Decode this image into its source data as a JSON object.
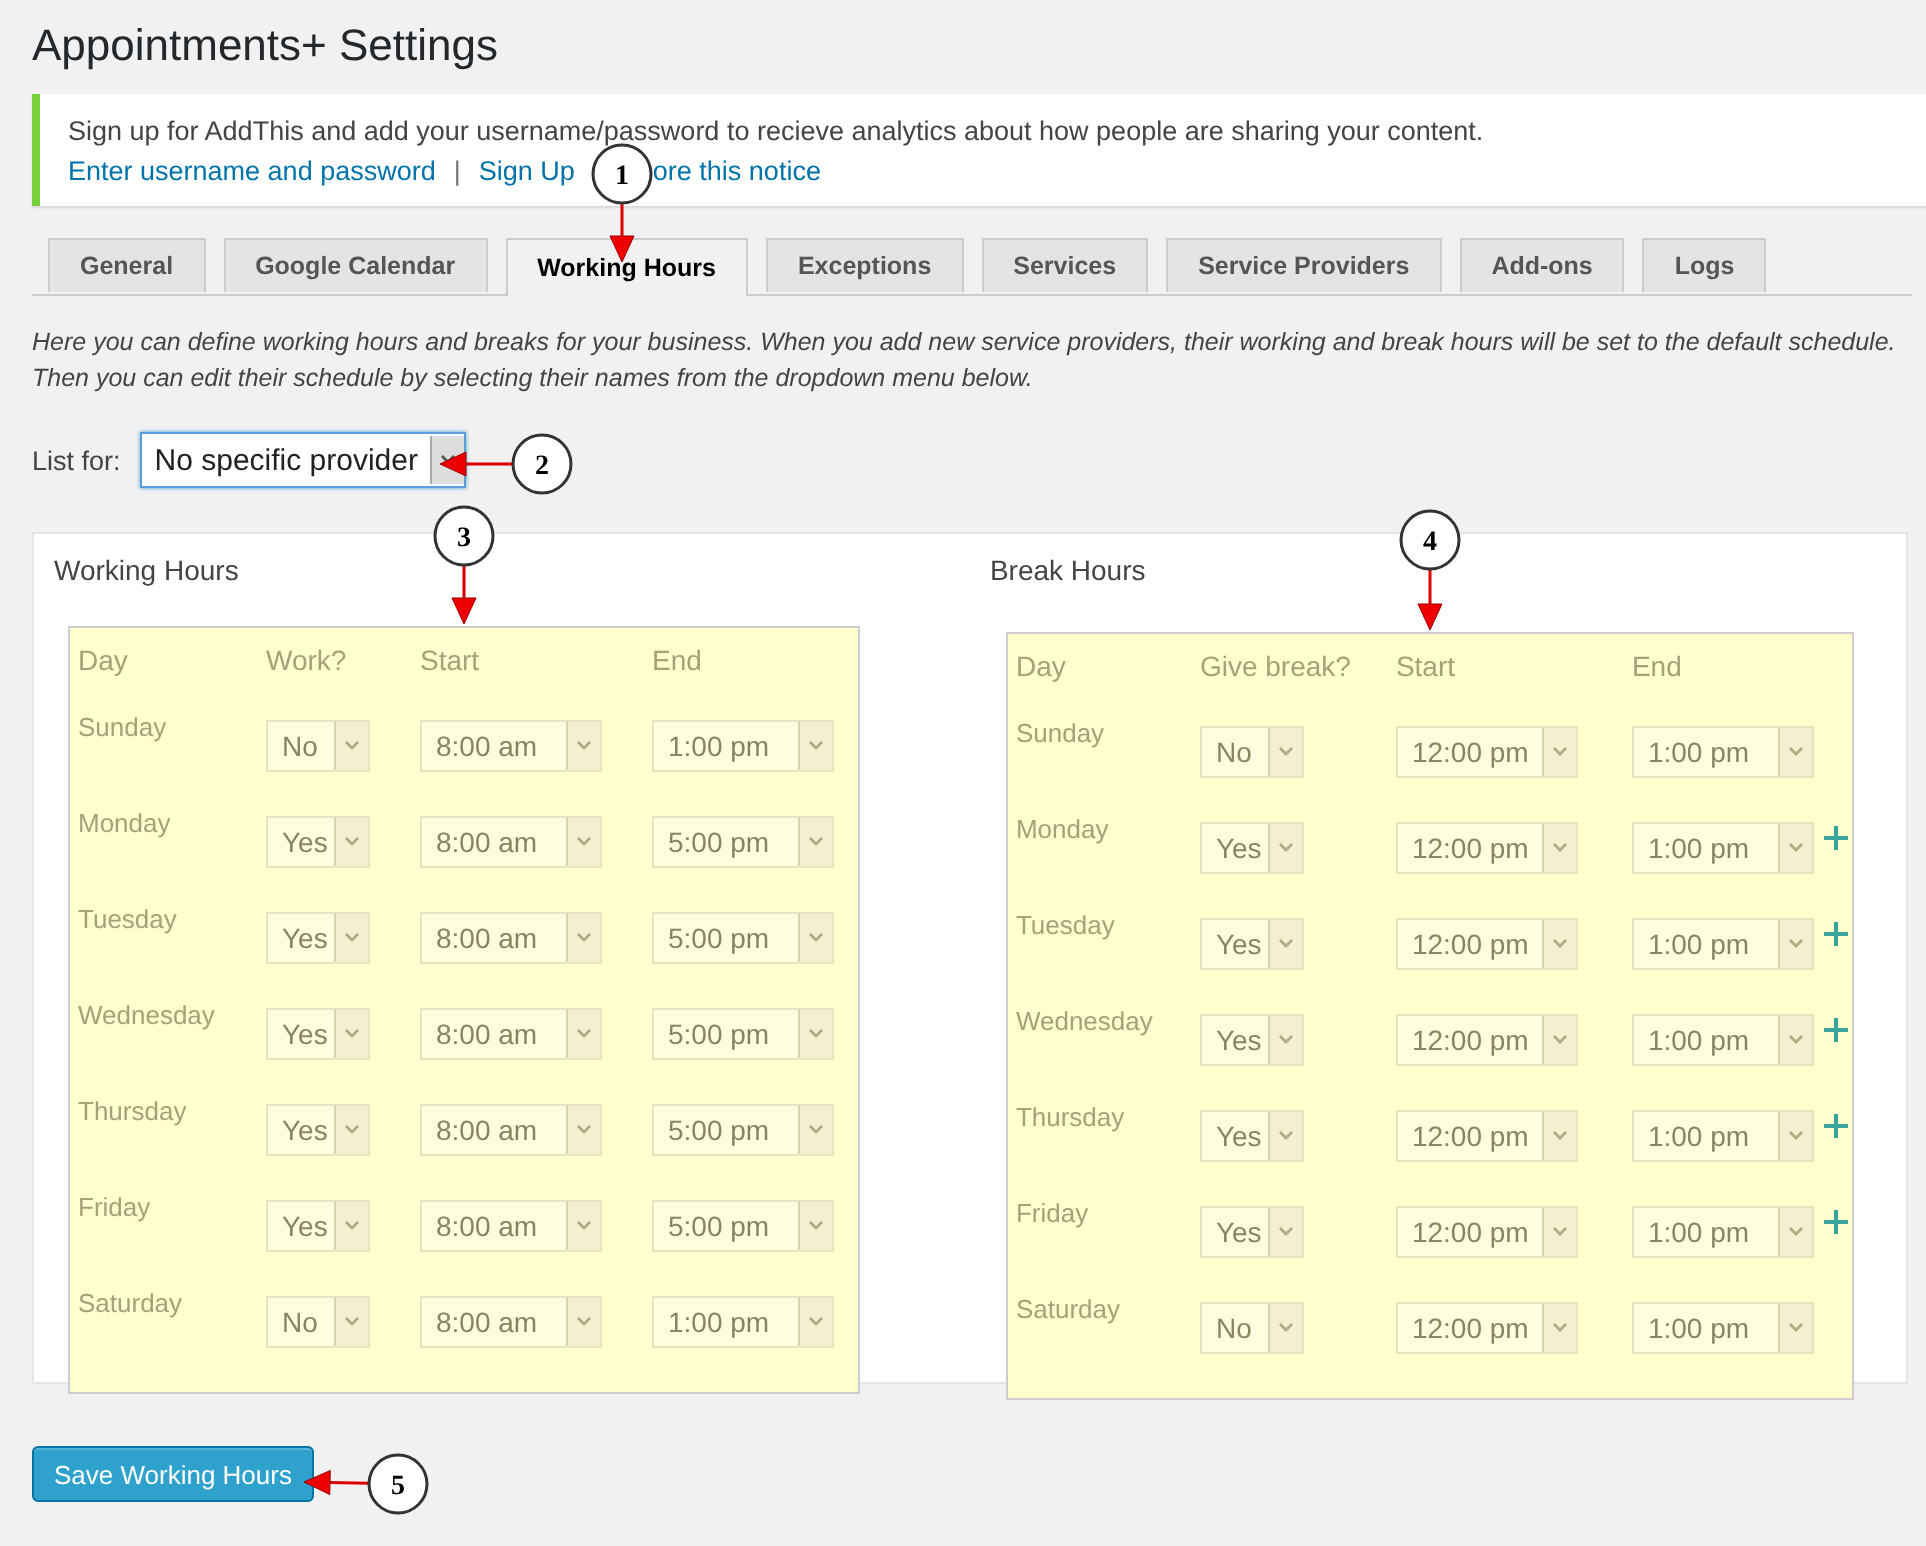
{
  "page_title": "Appointments+ Settings",
  "notice": {
    "message": "Sign up for AddThis and add your username/password to recieve analytics about how people are sharing your content.",
    "links": [
      "Enter username and password",
      "Sign Up",
      "ore this notice"
    ],
    "separator": "|"
  },
  "tabs": [
    {
      "label": "General",
      "selected": false
    },
    {
      "label": "Google Calendar",
      "selected": false
    },
    {
      "label": "Working Hours",
      "selected": true
    },
    {
      "label": "Exceptions",
      "selected": false
    },
    {
      "label": "Services",
      "selected": false
    },
    {
      "label": "Service Providers",
      "selected": false
    },
    {
      "label": "Add-ons",
      "selected": false
    },
    {
      "label": "Logs",
      "selected": false
    }
  ],
  "description": "Here you can define working hours and breaks for your business. When you add new service providers, their working and break hours will be set to the default schedule. Then you can edit their schedule by selecting their names from the dropdown menu below.",
  "list_for": {
    "label": "List for:",
    "value": "No specific provider"
  },
  "working_hours": {
    "title": "Working Hours",
    "columns": [
      "Day",
      "Work?",
      "Start",
      "End"
    ],
    "rows": [
      {
        "day": "Sunday",
        "active": "No",
        "start": "8:00 am",
        "end": "1:00 pm"
      },
      {
        "day": "Monday",
        "active": "Yes",
        "start": "8:00 am",
        "end": "5:00 pm"
      },
      {
        "day": "Tuesday",
        "active": "Yes",
        "start": "8:00 am",
        "end": "5:00 pm"
      },
      {
        "day": "Wednesday",
        "active": "Yes",
        "start": "8:00 am",
        "end": "5:00 pm"
      },
      {
        "day": "Thursday",
        "active": "Yes",
        "start": "8:00 am",
        "end": "5:00 pm"
      },
      {
        "day": "Friday",
        "active": "Yes",
        "start": "8:00 am",
        "end": "5:00 pm"
      },
      {
        "day": "Saturday",
        "active": "No",
        "start": "8:00 am",
        "end": "1:00 pm"
      }
    ]
  },
  "break_hours": {
    "title": "Break Hours",
    "columns": [
      "Day",
      "Give break?",
      "Start",
      "End"
    ],
    "rows": [
      {
        "day": "Sunday",
        "active": "No",
        "start": "12:00 pm",
        "end": "1:00 pm",
        "add_button": false
      },
      {
        "day": "Monday",
        "active": "Yes",
        "start": "12:00 pm",
        "end": "1:00 pm",
        "add_button": true
      },
      {
        "day": "Tuesday",
        "active": "Yes",
        "start": "12:00 pm",
        "end": "1:00 pm",
        "add_button": true
      },
      {
        "day": "Wednesday",
        "active": "Yes",
        "start": "12:00 pm",
        "end": "1:00 pm",
        "add_button": true
      },
      {
        "day": "Thursday",
        "active": "Yes",
        "start": "12:00 pm",
        "end": "1:00 pm",
        "add_button": true
      },
      {
        "day": "Friday",
        "active": "Yes",
        "start": "12:00 pm",
        "end": "1:00 pm",
        "add_button": true
      },
      {
        "day": "Saturday",
        "active": "No",
        "start": "12:00 pm",
        "end": "1:00 pm",
        "add_button": false
      }
    ]
  },
  "save_button": "Save Working Hours",
  "callouts": [
    "1",
    "2",
    "3",
    "4",
    "5"
  ]
}
